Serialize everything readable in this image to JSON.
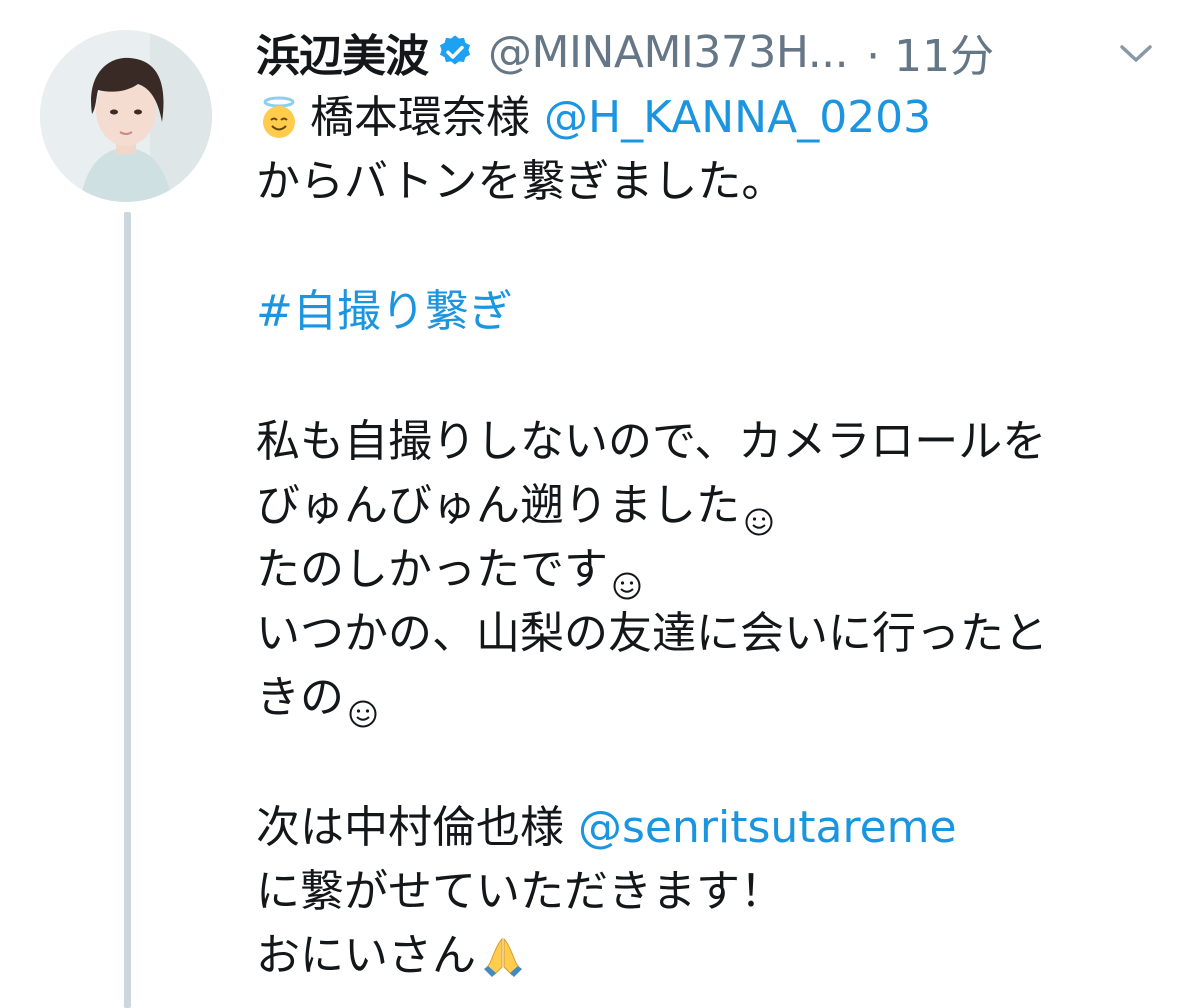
{
  "tweet": {
    "display_name": "浜辺美波",
    "handle": "@MINAMI373H...",
    "time": "· 11分",
    "mention_1_name": "橋本環奈様",
    "mention_1_handle": "@H_KANNA_0203",
    "line_baton": "からバトンを繋ぎました。",
    "hashtag": "#自撮り繋ぎ",
    "line_a": "私も自撮りしないので、カメラロールを",
    "line_b": "びゅんびゅん遡りました",
    "line_c": "たのしかったです",
    "line_d": "いつかの、山梨の友達に会いに行ったと",
    "line_e": "きの",
    "line_next": "次は中村倫也様",
    "mention_2_handle": "@senritsutareme",
    "line_connect": "に繋がせていただきます！",
    "line_onii": "おにいさん"
  },
  "icons": {
    "verified": "verified-badge-icon",
    "menu": "chevron-down-icon",
    "angel": "angel-emoji-icon",
    "smile": "smiley-icon",
    "pray": "folded-hands-emoji-icon"
  },
  "colors": {
    "link": "#1b95e0",
    "muted": "#657786",
    "verified": "#1da1f2",
    "thread_line": "#ccd6dd"
  }
}
